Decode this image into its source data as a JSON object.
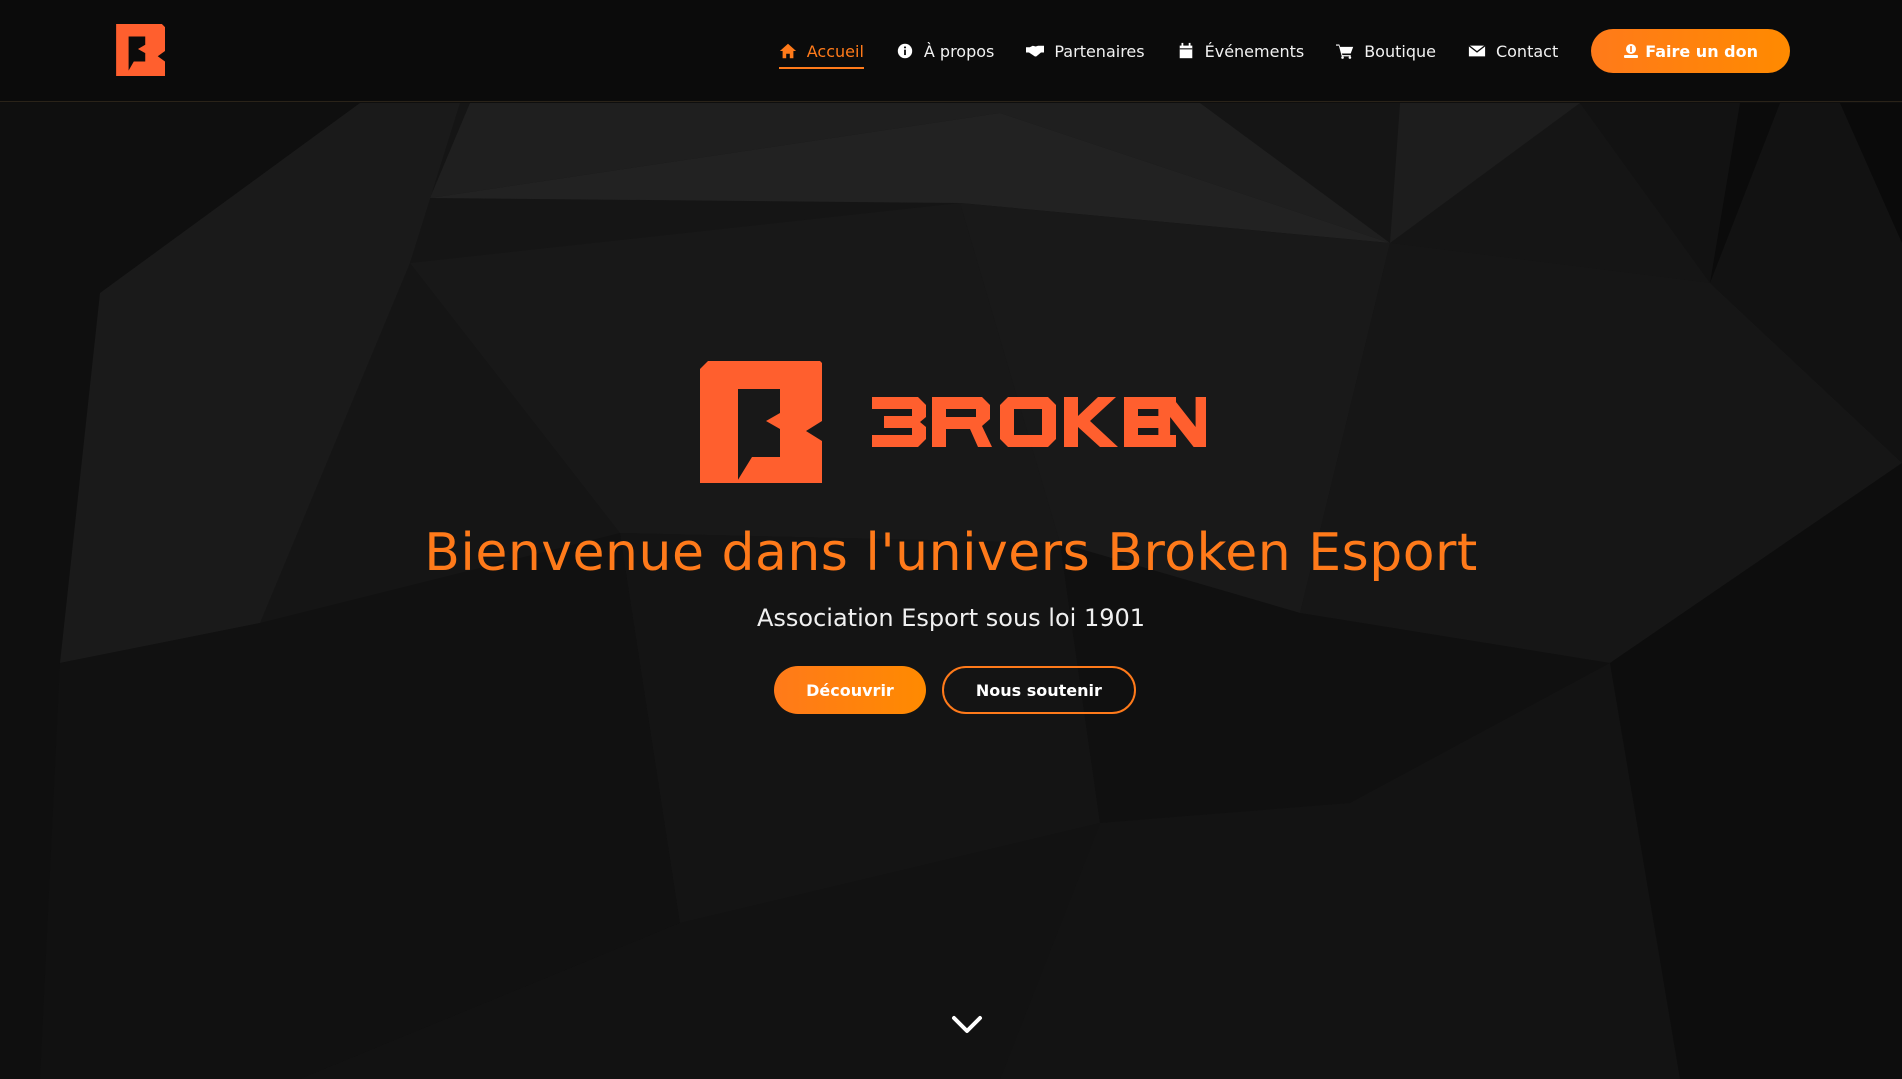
{
  "header": {
    "logo_icon": "broken-b-logo-icon",
    "nav": [
      {
        "label": "Accueil",
        "icon": "home-icon",
        "active": true
      },
      {
        "label": "À propos",
        "icon": "info-icon",
        "active": false
      },
      {
        "label": "Partenaires",
        "icon": "handshake-icon",
        "active": false
      },
      {
        "label": "Événements",
        "icon": "calendar-icon",
        "active": false
      },
      {
        "label": "Boutique",
        "icon": "cart-icon",
        "active": false
      },
      {
        "label": "Contact",
        "icon": "envelope-icon",
        "active": false
      }
    ],
    "donate_label": "Faire un don",
    "donate_icon": "donate-icon"
  },
  "hero": {
    "logo_wordmark": "BROKEN",
    "title": "Bienvenue dans l'univers Broken Esport",
    "subtitle": "Association Esport sous loi 1901",
    "primary_button": "Découvrir",
    "secondary_button": "Nous soutenir",
    "scroll_icon": "chevron-down-icon"
  },
  "colors": {
    "accent": "#ff7a1a",
    "logo_orange": "#ff5f2e",
    "background": "#151515",
    "header_background": "#0b0b0b"
  }
}
